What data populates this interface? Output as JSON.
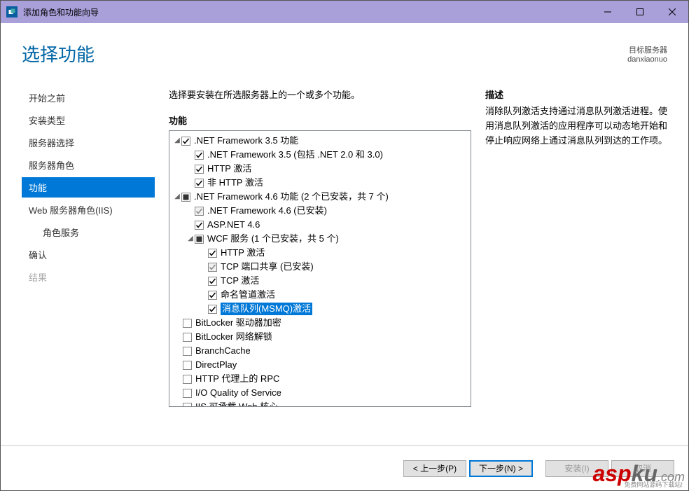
{
  "title": "添加角色和功能向导",
  "page_title": "选择功能",
  "server_info": {
    "label": "目标服务器",
    "name": "danxiaonuo"
  },
  "sidebar": {
    "items": [
      {
        "label": "开始之前",
        "active": false
      },
      {
        "label": "安装类型",
        "active": false
      },
      {
        "label": "服务器选择",
        "active": false
      },
      {
        "label": "服务器角色",
        "active": false
      },
      {
        "label": "功能",
        "active": true
      },
      {
        "label": "Web 服务器角色(IIS)",
        "active": false
      },
      {
        "label": "角色服务",
        "active": false,
        "sub": true
      },
      {
        "label": "确认",
        "active": false
      },
      {
        "label": "结果",
        "active": false,
        "disabled": true
      }
    ]
  },
  "instruction": "选择要安装在所选服务器上的一个或多个功能。",
  "features_label": "功能",
  "description_label": "描述",
  "description_text": "消除队列激活支持通过消息队列激活进程。使用消息队列激活的应用程序可以动态地开始和停止响应网络上通过消息队列到达的工作项。",
  "tree": [
    {
      "level": 0,
      "arrow": "▼",
      "checked": true,
      "text": ".NET Framework 3.5 功能"
    },
    {
      "level": 1,
      "checked": true,
      "text": ".NET Framework 3.5 (包括 .NET 2.0 和 3.0)"
    },
    {
      "level": 1,
      "checked": true,
      "text": "HTTP 激活"
    },
    {
      "level": 1,
      "checked": true,
      "text": "非 HTTP 激活"
    },
    {
      "level": 0,
      "arrow": "▼",
      "mixed": true,
      "text": ".NET Framework 4.6 功能 (2 个已安装，共 7 个)"
    },
    {
      "level": 1,
      "checked": true,
      "disabled": true,
      "text": ".NET Framework 4.6 (已安装)"
    },
    {
      "level": 1,
      "checked": true,
      "text": "ASP.NET 4.6"
    },
    {
      "level": 1,
      "arrow": "▼",
      "mixed": true,
      "text": "WCF 服务 (1 个已安装，共 5 个)"
    },
    {
      "level": 2,
      "checked": true,
      "text": "HTTP 激活"
    },
    {
      "level": 2,
      "checked": true,
      "disabled": true,
      "text": "TCP 端口共享 (已安装)"
    },
    {
      "level": 2,
      "checked": true,
      "text": "TCP 激活"
    },
    {
      "level": 2,
      "checked": true,
      "text": "命名管道激活"
    },
    {
      "level": 2,
      "checked": true,
      "selected": true,
      "text": "消息队列(MSMQ)激活"
    },
    {
      "level": 0,
      "cbonly": true,
      "checked": false,
      "text": "BitLocker 驱动器加密"
    },
    {
      "level": 0,
      "cbonly": true,
      "checked": false,
      "text": "BitLocker 网络解锁"
    },
    {
      "level": 0,
      "cbonly": true,
      "checked": false,
      "text": "BranchCache"
    },
    {
      "level": 0,
      "cbonly": true,
      "checked": false,
      "text": "DirectPlay"
    },
    {
      "level": 0,
      "cbonly": true,
      "checked": false,
      "text": "HTTP 代理上的 RPC"
    },
    {
      "level": 0,
      "cbonly": true,
      "checked": false,
      "text": "I/O Quality of Service"
    },
    {
      "level": 0,
      "cbonly": true,
      "checked": false,
      "text": "IIS 可承载 Web 核心"
    }
  ],
  "buttons": {
    "prev": "< 上一步(P)",
    "next": "下一步(N) >",
    "install": "安装(I)",
    "cancel": "取消"
  },
  "watermark": {
    "a": "asp",
    "b": "ku",
    "c": ".com",
    "sub": "免费网站源码下载站!"
  }
}
